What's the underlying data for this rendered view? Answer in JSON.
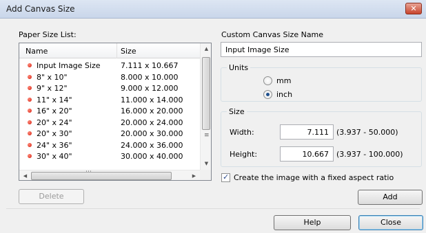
{
  "window": {
    "title": "Add Canvas Size",
    "close_glyph": "✕"
  },
  "paper_list": {
    "label": "Paper Size List:",
    "columns": {
      "name": "Name",
      "size": "Size"
    },
    "rows": [
      {
        "name": "Input Image Size",
        "size": "7.111 x 10.667"
      },
      {
        "name": "8\" x 10\"",
        "size": "8.000 x 10.000"
      },
      {
        "name": "9\" x 12\"",
        "size": "9.000 x 12.000"
      },
      {
        "name": "11\" x 14\"",
        "size": "11.000 x 14.000"
      },
      {
        "name": "16\" x 20\"",
        "size": "16.000 x 20.000"
      },
      {
        "name": "20\" x 24\"",
        "size": "20.000 x 24.000"
      },
      {
        "name": "20\" x 30\"",
        "size": "20.000 x 30.000"
      },
      {
        "name": "24\" x 36\"",
        "size": "24.000 x 36.000"
      },
      {
        "name": "30\" x 40\"",
        "size": "30.000 x 40.000"
      }
    ],
    "delete_label": "Delete"
  },
  "custom": {
    "name_label": "Custom Canvas Size Name",
    "name_value": "Input Image Size"
  },
  "units": {
    "group_label": "Units",
    "mm_label": "mm",
    "inch_label": "inch",
    "selected": "inch"
  },
  "size": {
    "group_label": "Size",
    "width_label": "Width:",
    "width_value": "7.111",
    "width_range": "(3.937 - 50.000)",
    "height_label": "Height:",
    "height_value": "10.667",
    "height_range": "(3.937 - 100.000)"
  },
  "aspect": {
    "label": "Create the image with a fixed aspect ratio",
    "checked": true
  },
  "buttons": {
    "add": "Add",
    "help": "Help",
    "close": "Close"
  },
  "colors": {
    "title_bg": "#c9d6ea",
    "close_red": "#c8442c",
    "bullet_red": "#d41c0c",
    "default_btn_border": "#3c7fb1"
  }
}
